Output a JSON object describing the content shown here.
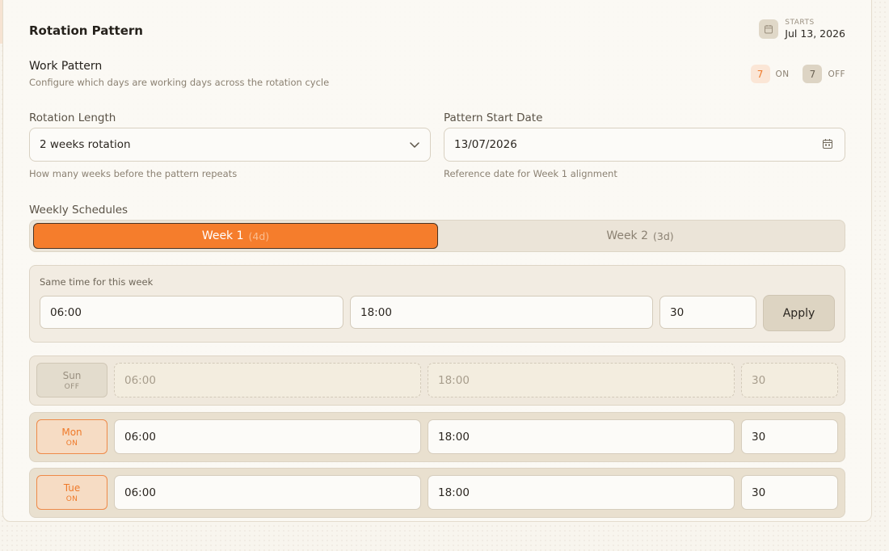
{
  "header": {
    "title": "Rotation Pattern",
    "starts_label": "STARTS",
    "starts_date": "Jul 13, 2026"
  },
  "work_pattern": {
    "title": "Work Pattern",
    "subtitle": "Configure which days are working days across the rotation cycle",
    "on_count": "7",
    "on_label": "ON",
    "off_count": "7",
    "off_label": "OFF"
  },
  "rotation_length": {
    "label": "Rotation Length",
    "value": "2 weeks rotation",
    "helper": "How many weeks before the pattern repeats"
  },
  "pattern_start": {
    "label": "Pattern Start Date",
    "value": "13/07/2026",
    "helper": "Reference date for Week 1 alignment"
  },
  "weekly": {
    "label": "Weekly Schedules",
    "tabs": [
      {
        "label": "Week 1",
        "count": "(4d)",
        "active": true
      },
      {
        "label": "Week 2",
        "count": "(3d)",
        "active": false
      }
    ]
  },
  "same_time": {
    "label": "Same time for this week",
    "start": "06:00",
    "end": "18:00",
    "break": "30",
    "apply_label": "Apply"
  },
  "days": [
    {
      "name": "Sun",
      "status": "OFF",
      "start": "06:00",
      "end": "18:00",
      "break": "30"
    },
    {
      "name": "Mon",
      "status": "ON",
      "start": "06:00",
      "end": "18:00",
      "break": "30"
    },
    {
      "name": "Tue",
      "status": "ON",
      "start": "06:00",
      "end": "18:00",
      "break": "30"
    }
  ],
  "colors": {
    "accent": "#f57d2c",
    "background": "#f8f5ee"
  }
}
